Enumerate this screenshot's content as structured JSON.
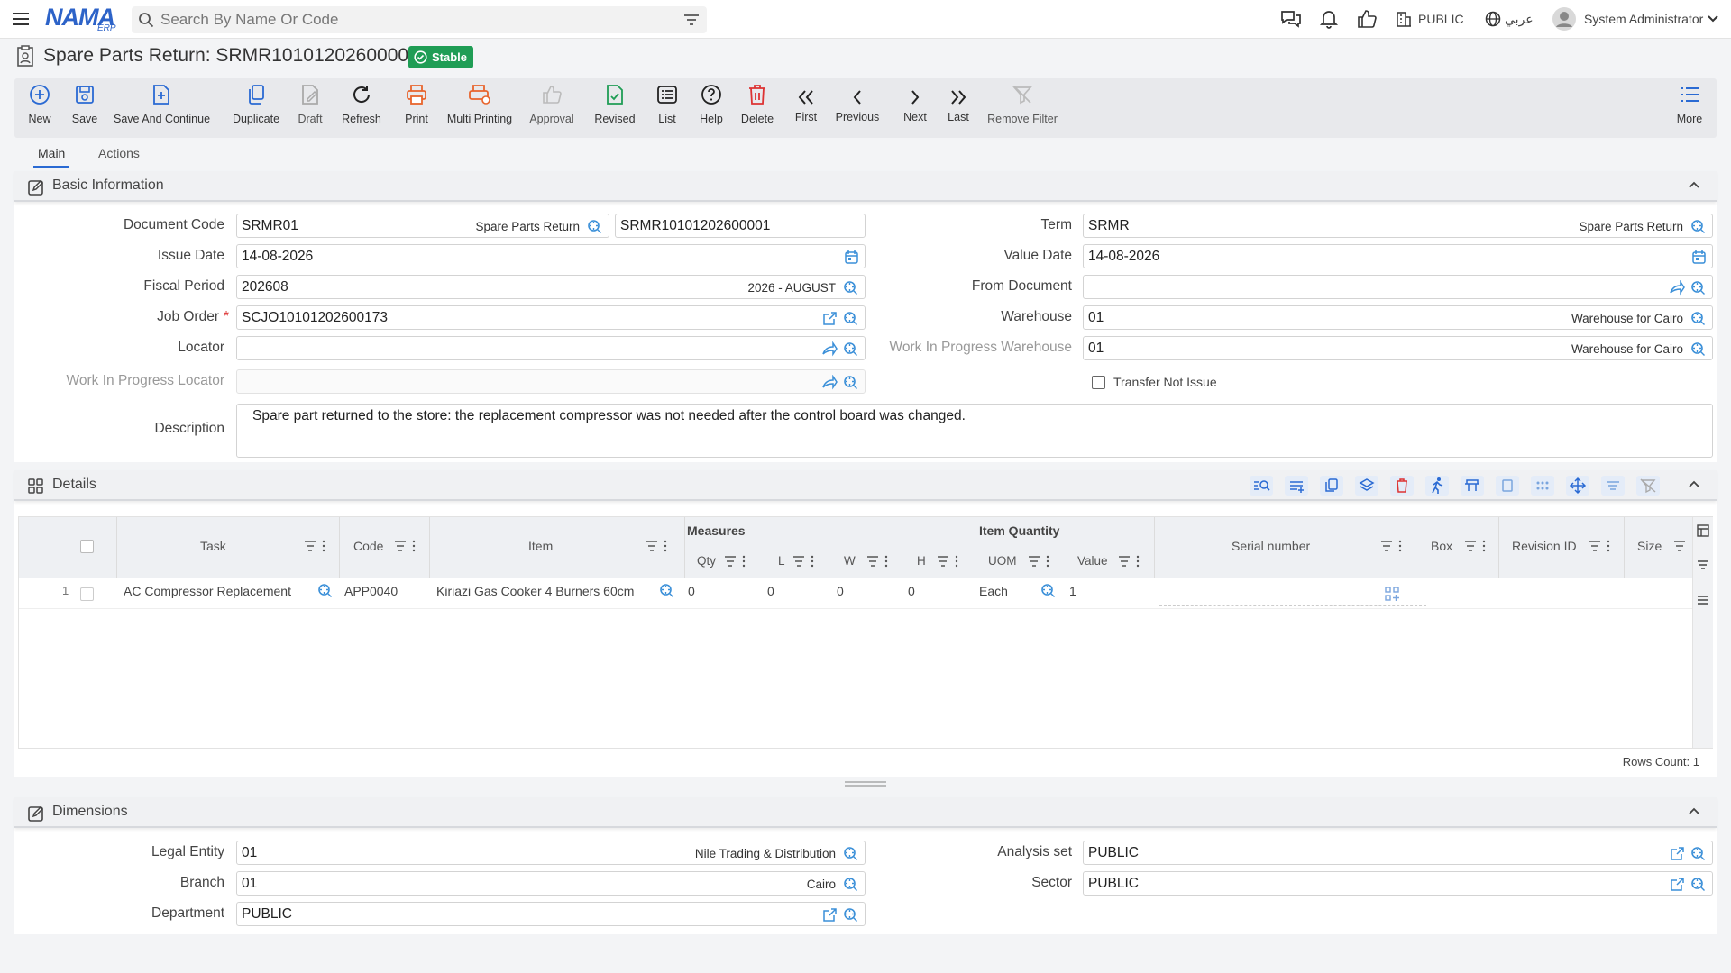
{
  "header": {
    "logo": "NAMA",
    "logo_sub": "ERP",
    "search_placeholder": "Search By Name Or Code",
    "public_label": "PUBLIC",
    "language": "عربي",
    "user": "System Administrator"
  },
  "page": {
    "title": "Spare Parts Return: SRMR10101202600001",
    "status": "Stable"
  },
  "toolbar": {
    "new": "New",
    "save": "Save",
    "save_continue": "Save And Continue",
    "duplicate": "Duplicate",
    "draft": "Draft",
    "refresh": "Refresh",
    "print": "Print",
    "multi_printing": "Multi Printing",
    "approval": "Approval",
    "revised": "Revised",
    "list": "List",
    "help": "Help",
    "delete": "Delete",
    "first": "First",
    "previous": "Previous",
    "next": "Next",
    "last": "Last",
    "remove_filter": "Remove Filter",
    "more": "More"
  },
  "tabs": {
    "main": "Main",
    "actions": "Actions"
  },
  "basic": {
    "title": "Basic Information",
    "document_code": {
      "label": "Document Code",
      "value": "SRMR01",
      "desc": "Spare Parts Return",
      "code": "SRMR10101202600001"
    },
    "issue_date": {
      "label": "Issue Date",
      "value": "14-08-2026"
    },
    "fiscal_period": {
      "label": "Fiscal Period",
      "value": "202608",
      "desc": "2026 - AUGUST"
    },
    "job_order": {
      "label": "Job Order",
      "value": "SCJO10101202600173"
    },
    "locator": {
      "label": "Locator",
      "value": ""
    },
    "wip_locator": {
      "label": "Work In Progress Locator",
      "value": ""
    },
    "description": {
      "label": "Description",
      "value": "Spare part returned to the store: the replacement compressor was not needed after the control board was changed."
    },
    "term": {
      "label": "Term",
      "value": "SRMR",
      "desc": "Spare Parts Return"
    },
    "value_date": {
      "label": "Value Date",
      "value": "14-08-2026"
    },
    "from_document": {
      "label": "From Document",
      "value": ""
    },
    "warehouse": {
      "label": "Warehouse",
      "value": "01",
      "desc": "Warehouse for Cairo"
    },
    "wip_warehouse": {
      "label": "Work In Progress Warehouse",
      "value": "01",
      "desc": "Warehouse for Cairo"
    },
    "transfer_not_issue": {
      "label": "Transfer Not Issue",
      "checked": false
    }
  },
  "details": {
    "title": "Details",
    "group_measures": "Measures",
    "group_item_quantity": "Item Quantity",
    "columns": {
      "task": "Task",
      "code": "Code",
      "item": "Item",
      "qty": "Qty",
      "l": "L",
      "w": "W",
      "h": "H",
      "uom": "UOM",
      "value": "Value",
      "serial": "Serial number",
      "box": "Box",
      "revision": "Revision ID",
      "size": "Size"
    },
    "rows": [
      {
        "no": "1",
        "task": "AC Compressor Replacement",
        "code": "APP0040",
        "item": "Kiriazi Gas Cooker 4 Burners 60cm",
        "qty": "0",
        "l": "0",
        "w": "0",
        "h": "0",
        "uom": "Each",
        "value": "1",
        "serial": "",
        "box": "",
        "revision": "",
        "size": ""
      }
    ],
    "rows_count": "Rows Count: 1"
  },
  "dimensions": {
    "title": "Dimensions",
    "legal_entity": {
      "label": "Legal Entity",
      "value": "01",
      "desc": "Nile Trading & Distribution"
    },
    "branch": {
      "label": "Branch",
      "value": "01",
      "desc": "Cairo"
    },
    "department": {
      "label": "Department",
      "value": "PUBLIC"
    },
    "analysis_set": {
      "label": "Analysis set",
      "value": "PUBLIC"
    },
    "sector": {
      "label": "Sector",
      "value": "PUBLIC"
    }
  }
}
